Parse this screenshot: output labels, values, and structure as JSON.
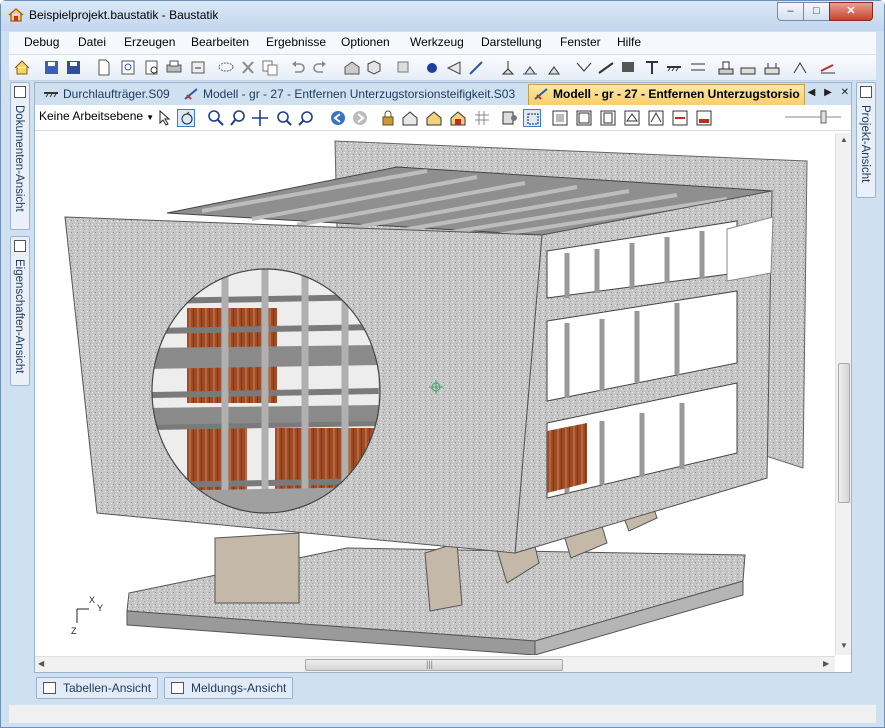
{
  "window": {
    "title": "Beispielprojekt.baustatik - Baustatik",
    "minimize_glyph": "‒",
    "maximize_glyph": "□",
    "close_glyph": "✕"
  },
  "menu": [
    "Debug",
    "Datei",
    "Erzeugen",
    "Bearbeiten",
    "Ergebnisse",
    "Optionen",
    "Werkzeug",
    "Darstellung",
    "Fenster",
    "Hilfe"
  ],
  "left_dock": {
    "documents_label": "Dokumenten-Ansicht",
    "properties_label": "Eigenschaften-Ansicht"
  },
  "right_dock": {
    "project_label": "Projekt-Ansicht"
  },
  "tabs": [
    {
      "label": "Durchlaufträger.S09",
      "icon": "beam-icon",
      "active": false
    },
    {
      "label": "Modell - gr - 27 - Entfernen Unterzugstorsionsteifigkeit.S03",
      "icon": "model-icon",
      "active": false
    },
    {
      "label": "Modell - gr - 27 - Entfernen Unterzugstorsio",
      "icon": "model-icon",
      "active": true
    }
  ],
  "tab_nav": {
    "left": "◀",
    "right": "▶",
    "close": "✕"
  },
  "view_toolbar": {
    "layer_select": "Keine Arbeitsebene"
  },
  "axes": {
    "x": "X",
    "y": "Y",
    "z": "Z"
  },
  "bottom_tabs": [
    "Tabellen-Ansicht",
    "Meldungs-Ansicht"
  ],
  "scroll_glyphs": {
    "up": "▲",
    "down": "▼",
    "left": "◀",
    "right": "▶",
    "grip": "|||"
  },
  "colors": {
    "accent": "#f6cf6a",
    "concrete": "#c8c8c8",
    "brick": "#a0522d"
  }
}
